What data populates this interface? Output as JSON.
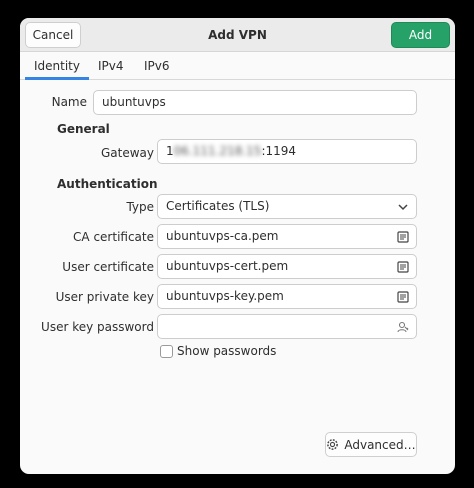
{
  "header": {
    "title": "Add VPN",
    "cancel_label": "Cancel",
    "add_label": "Add"
  },
  "tabs": [
    {
      "label": "Identity",
      "active": true
    },
    {
      "label": "IPv4",
      "active": false
    },
    {
      "label": "IPv6",
      "active": false
    }
  ],
  "form": {
    "name_label": "Name",
    "name_value": "ubuntuvps",
    "general_heading": "General",
    "gateway_label": "Gateway",
    "gateway_value_visible_prefix": "1",
    "gateway_value_blurred": "06.111.218.15",
    "gateway_value_suffix": ":1194",
    "authentication_heading": "Authentication",
    "type_label": "Type",
    "type_value": "Certificates (TLS)",
    "ca_cert_label": "CA certificate",
    "ca_cert_value": "ubuntuvps-ca.pem",
    "user_cert_label": "User certificate",
    "user_cert_value": "ubuntuvps-cert.pem",
    "user_key_label": "User private key",
    "user_key_value": "ubuntuvps-key.pem",
    "user_key_password_label": "User key password",
    "user_key_password_value": "",
    "show_passwords_label": "Show passwords",
    "show_passwords_checked": false
  },
  "footer": {
    "advanced_label": "Advanced…"
  },
  "colors": {
    "accent": "#3584e4",
    "add_button": "#26a269",
    "background": "#fafafa",
    "headerbar": "#ebebeb"
  },
  "icons": {
    "file_chooser": "document-open-icon",
    "password_options": "key-user-icon",
    "dropdown": "chevron-down-icon",
    "advanced": "gear-icon"
  }
}
